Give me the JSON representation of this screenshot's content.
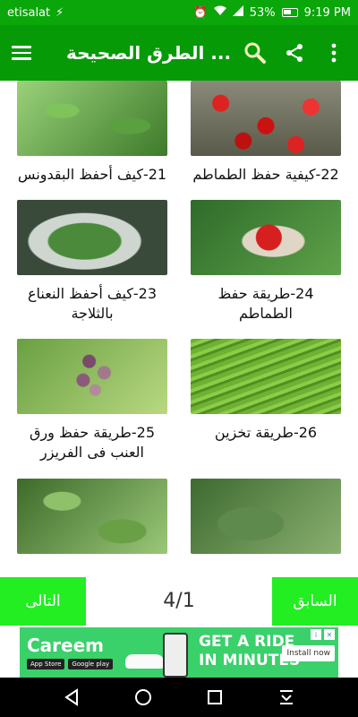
{
  "status_bar": {
    "carrier": "etisalat",
    "battery": "53%",
    "time": "9:19 PM"
  },
  "app_bar": {
    "title": "الطرق الصحيحة ..."
  },
  "cards": [
    {
      "caption": "22-كيفية حفظ الطماطم",
      "image": "tomatoes-in-boxes"
    },
    {
      "caption": "21-كيف أحفظ البقدونس",
      "image": "parsley-plant"
    },
    {
      "caption": "24-طريقة حفظ الطماطم",
      "image": "tomatoes-in-bag"
    },
    {
      "caption": "23-كيف أحفظ النعناع بالثلاجة",
      "image": "mint-in-bowl"
    },
    {
      "caption": "26-طريقة تخزين",
      "image": "green-beans"
    },
    {
      "caption": "25-طريقة حفظ ورق العنب فى الفريزر",
      "image": "grapes-on-vine"
    },
    {
      "caption": "",
      "image": "grape-leaves"
    },
    {
      "caption": "",
      "image": "mint-leaves"
    }
  ],
  "pager": {
    "next_label": "التالى",
    "prev_label": "السابق",
    "page_indicator": "4/1"
  },
  "ad": {
    "brand": "Careem",
    "app_store": "App Store",
    "google_play": "Google play",
    "headline_line1": "GET A RIDE",
    "headline_line2": "IN MINUTES",
    "install_label": "Install now"
  }
}
